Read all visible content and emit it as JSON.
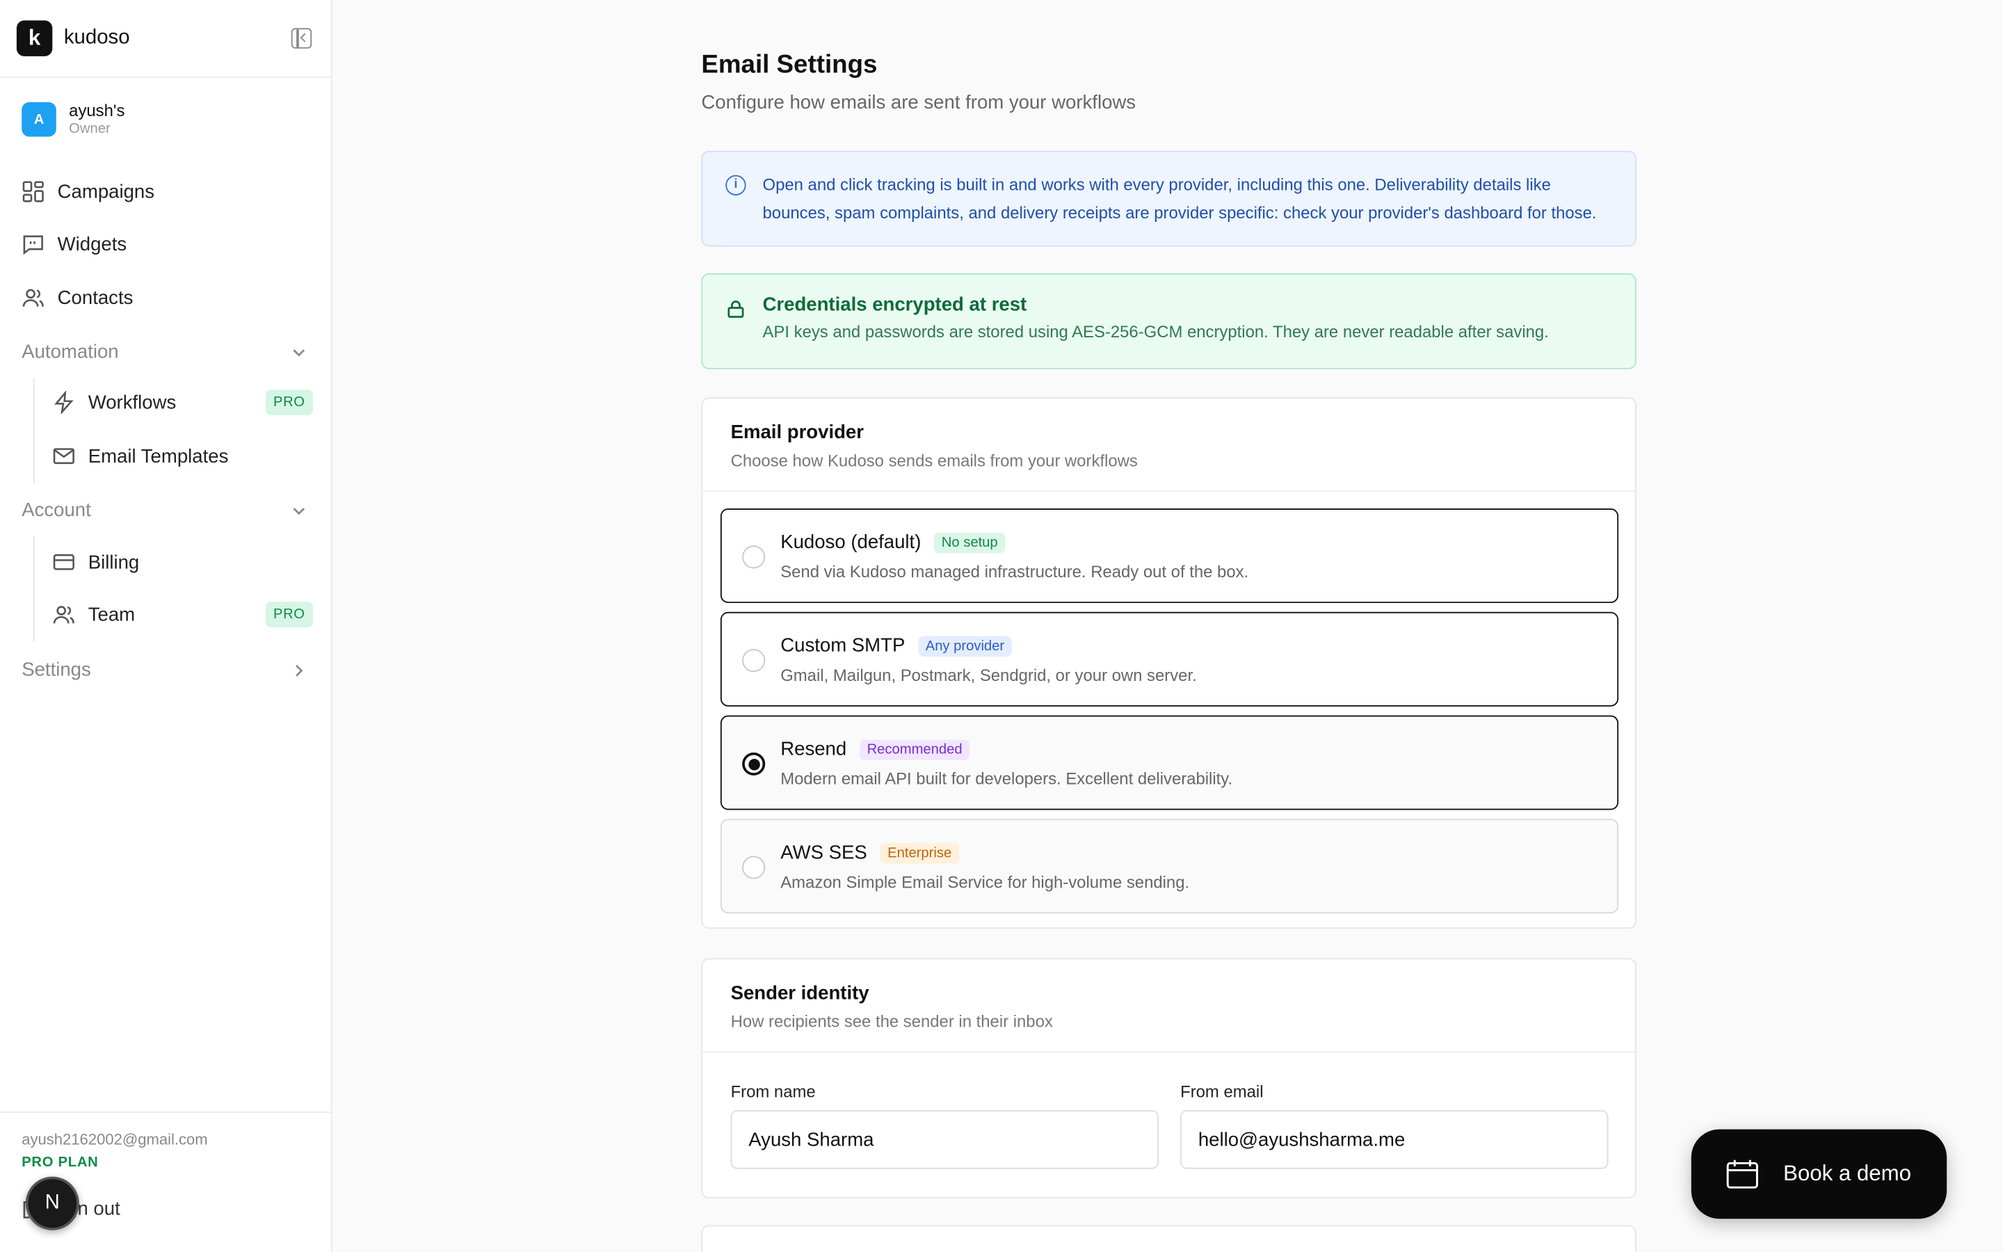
{
  "brand": {
    "name": "kudoso",
    "logo_letter": "k"
  },
  "account": {
    "initial": "A",
    "name": "ayush's",
    "role": "Owner"
  },
  "nav": {
    "campaigns": "Campaigns",
    "widgets": "Widgets",
    "contacts": "Contacts",
    "automation": "Automation",
    "workflows": "Workflows",
    "email_templates": "Email Templates",
    "account": "Account",
    "billing": "Billing",
    "team": "Team",
    "settings": "Settings",
    "pro_badge": "PRO"
  },
  "footer": {
    "email": "ayush2162002@gmail.com",
    "plan": "PRO PLAN",
    "signout": "Sign out",
    "n_badge": "N"
  },
  "page": {
    "title": "Email Settings",
    "subtitle": "Configure how emails are sent from your workflows"
  },
  "info_banner": {
    "icon": "info-icon",
    "text": "Open and click tracking is built in and works with every provider, including this one. Deliverability details like bounces, spam complaints, and delivery receipts are provider specific: check your provider's dashboard for those."
  },
  "secure_banner": {
    "title": "Credentials encrypted at rest",
    "text": "API keys and passwords are stored using AES-256-GCM encryption. They are never readable after saving."
  },
  "provider_card": {
    "title": "Email provider",
    "subtitle": "Choose how Kudoso sends emails from your workflows",
    "options": [
      {
        "name": "Kudoso (default)",
        "tag": "No setup",
        "desc": "Send via Kudoso managed infrastructure. Ready out of the box.",
        "selected": false
      },
      {
        "name": "Custom SMTP",
        "tag": "Any provider",
        "desc": "Gmail, Mailgun, Postmark, Sendgrid, or your own server.",
        "selected": false
      },
      {
        "name": "Resend",
        "tag": "Recommended",
        "desc": "Modern email API built for developers. Excellent deliverability.",
        "selected": true
      },
      {
        "name": "AWS SES",
        "tag": "Enterprise",
        "desc": "Amazon Simple Email Service for high-volume sending.",
        "selected": false
      }
    ]
  },
  "sender_card": {
    "title": "Sender identity",
    "subtitle": "How recipients see the sender in their inbox",
    "from_name_label": "From name",
    "from_name_value": "Ayush Sharma",
    "from_email_label": "From email",
    "from_email_value": "hello@ayushsharma.me"
  },
  "demo_button": {
    "label": "Book a demo"
  },
  "colors": {
    "accent": "#111111",
    "pro_green": "#0e8a4a",
    "info_blue": "#1f4fa8",
    "secure_green": "#0c6b3a"
  }
}
